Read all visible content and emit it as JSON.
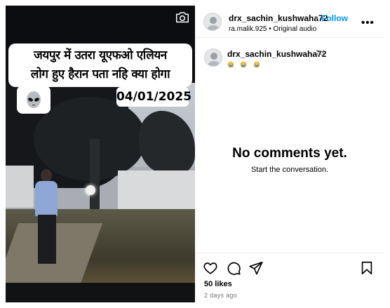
{
  "video": {
    "headline": "जयपुर में उतरा यूएफओ एलियन\nलोग हुए हैरान पता नहि क्या होगा",
    "date_badge": "04/01/2025",
    "alien_icon": "alien-icon",
    "camera_icon": "camera-icon"
  },
  "header": {
    "username": "drx_sachin_kushwaha72",
    "separator": "•",
    "follow_label": "Follow",
    "audio_owner": "ra.malik.925",
    "audio_label": "Original audio",
    "more_icon": "more-options-icon",
    "more_label": "•••"
  },
  "caption": {
    "username": "drx_sachin_kushwaha72",
    "age": "2d",
    "emojis": [
      "crying-face-emoji",
      "crying-face-emoji",
      "crying-face-emoji"
    ]
  },
  "comments": {
    "empty_title": "No comments yet.",
    "empty_subtitle": "Start the conversation."
  },
  "actions": {
    "icons": [
      "heart-icon",
      "comment-icon",
      "share-icon",
      "bookmark-icon"
    ],
    "likes": "50 likes",
    "posted": "2 days ago"
  },
  "colors": {
    "follow": "#0095f6",
    "muted": "#737373",
    "media_bg": "#0b0d10"
  }
}
